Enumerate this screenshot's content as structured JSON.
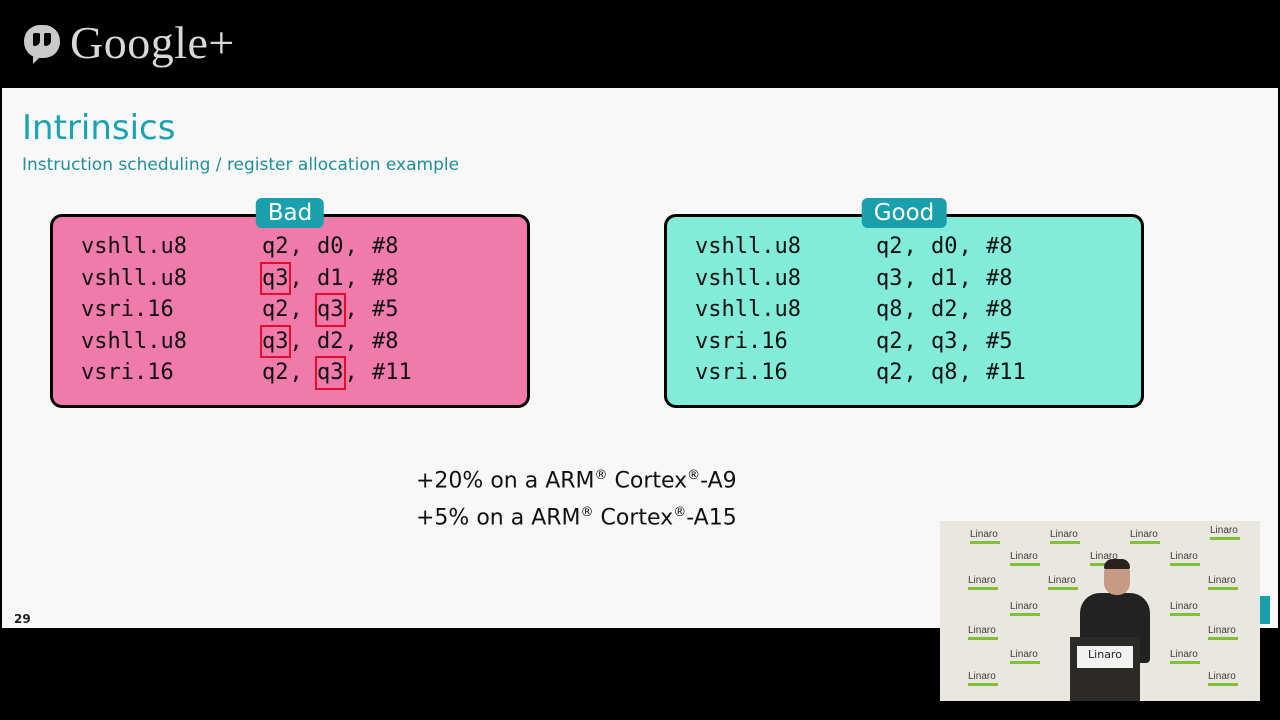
{
  "brand": {
    "name": "Google+"
  },
  "slide": {
    "title": "Intrinsics",
    "subtitle": "Instruction scheduling / register allocation example",
    "number": "29",
    "bad": {
      "label": "Bad",
      "rows": [
        {
          "op": "vshll.u8",
          "args": [
            "q2",
            "d0",
            "#8"
          ]
        },
        {
          "op": "vshll.u8",
          "args": [
            "q3",
            "d1",
            "#8"
          ]
        },
        {
          "op": "vsri.16",
          "args": [
            "q2",
            "q3",
            "#5"
          ]
        },
        {
          "op": "vshll.u8",
          "args": [
            "q3",
            "d2",
            "#8"
          ]
        },
        {
          "op": "vsri.16",
          "args": [
            "q2",
            "q3",
            "#11"
          ]
        }
      ]
    },
    "good": {
      "label": "Good",
      "rows": [
        {
          "op": "vshll.u8",
          "args": [
            "q2",
            "d0",
            "#8"
          ]
        },
        {
          "op": "vshll.u8",
          "args": [
            "q3",
            "d1",
            "#8"
          ]
        },
        {
          "op": "vshll.u8",
          "args": [
            "q8",
            "d2",
            "#8"
          ]
        },
        {
          "op": "vsri.16",
          "args": [
            "q2",
            "q3",
            "#5"
          ]
        },
        {
          "op": "vsri.16",
          "args": [
            "q2",
            "q8",
            "#11"
          ]
        }
      ]
    },
    "results": [
      {
        "pct": "+20% on a ARM",
        "mid": " Cortex",
        "cpu": "-A9"
      },
      {
        "pct": "+5% on a ARM",
        "mid": " Cortex",
        "cpu": "-A15"
      }
    ],
    "reg_mark": "®"
  },
  "video": {
    "backdrop_logo": "Linaro",
    "podium_sign": "Linaro"
  },
  "colors": {
    "accent": "#1aa0ad",
    "bad_bg": "#f07aa9",
    "good_bg": "#82ecd9",
    "highlight": "#e0102a"
  }
}
